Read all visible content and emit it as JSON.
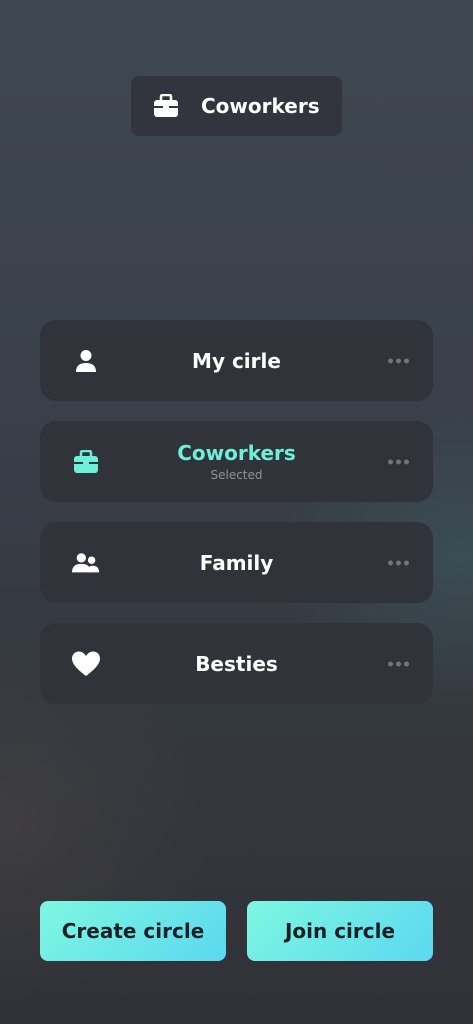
{
  "header": {
    "current_circle": "Coworkers",
    "icon": "briefcase-icon"
  },
  "circles": [
    {
      "name": "My cirle",
      "icon": "person-icon",
      "subtitle": ""
    },
    {
      "name": "Coworkers",
      "icon": "briefcase-icon",
      "subtitle": "Selected"
    },
    {
      "name": "Family",
      "icon": "group-icon",
      "subtitle": ""
    },
    {
      "name": "Besties",
      "icon": "heart-icon",
      "subtitle": ""
    }
  ],
  "actions": {
    "create_label": "Create circle",
    "join_label": "Join circle"
  },
  "colors": {
    "accent": "#6ef0d8",
    "button_gradient_start": "#7ef7e0",
    "button_gradient_end": "#5ad8f0",
    "card": "#30333a"
  }
}
